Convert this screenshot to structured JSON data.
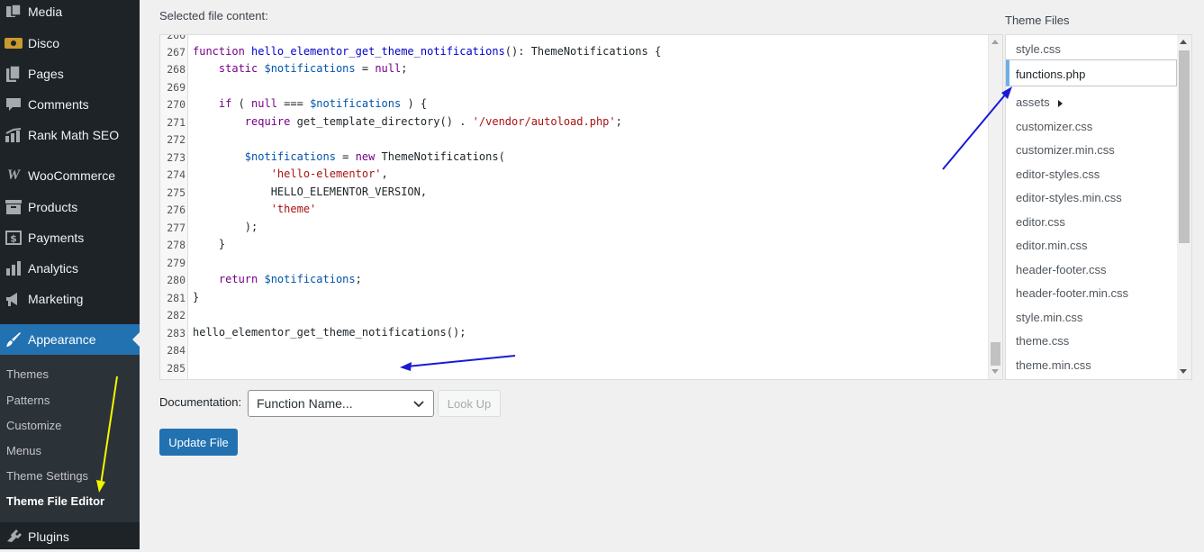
{
  "sidebar": {
    "menu": [
      {
        "label": "Media",
        "icon": "media-icon"
      },
      {
        "label": "Disco",
        "icon": "disco-icon"
      },
      {
        "label": "Pages",
        "icon": "pages-icon"
      },
      {
        "label": "Comments",
        "icon": "comments-icon"
      },
      {
        "label": "Rank Math SEO",
        "icon": "rank-math-icon"
      },
      {
        "label": "WooCommerce",
        "icon": "woocommerce-icon"
      },
      {
        "label": "Products",
        "icon": "products-icon"
      },
      {
        "label": "Payments",
        "icon": "payments-icon"
      },
      {
        "label": "Analytics",
        "icon": "analytics-icon"
      },
      {
        "label": "Marketing",
        "icon": "marketing-icon"
      },
      {
        "label": "Appearance",
        "icon": "appearance-icon"
      },
      {
        "label": "Plugins",
        "icon": "plugins-icon"
      }
    ],
    "submenu": [
      "Themes",
      "Patterns",
      "Customize",
      "Menus",
      "Theme Settings",
      "Theme File Editor"
    ]
  },
  "editor": {
    "label": "Selected file content:",
    "lines": [
      {
        "n": "267"
      },
      {
        "n": "268"
      },
      {
        "n": "269"
      },
      {
        "n": "270"
      },
      {
        "n": "271"
      },
      {
        "n": "272"
      },
      {
        "n": "273"
      },
      {
        "n": "274"
      },
      {
        "n": "275"
      },
      {
        "n": "276"
      },
      {
        "n": "277"
      },
      {
        "n": "278"
      },
      {
        "n": "279"
      },
      {
        "n": "280"
      },
      {
        "n": "281"
      },
      {
        "n": "282"
      },
      {
        "n": "283"
      },
      {
        "n": "284"
      },
      {
        "n": "285"
      }
    ],
    "code": {
      "l267_kw": "function ",
      "l267_fn": "hello_elementor_get_theme_notifications",
      "l267_rest": "(): ThemeNotifications {",
      "l268_kw": "static ",
      "l268_var": "$notifications",
      "l268_rest": " = ",
      "l268_null": "null",
      "l268_end": ";",
      "l270_kw": "if",
      "l270_a": " ( ",
      "l270_null": "null",
      "l270_b": " === ",
      "l270_var": "$notifications",
      "l270_c": " ) {",
      "l271_kw": "require ",
      "l271_a": "get_template_directory() . ",
      "l271_str": "'/vendor/autoload.php'",
      "l271_b": ";",
      "l273_var": "$notifications",
      "l273_a": " = ",
      "l273_kw": "new ",
      "l273_b": "ThemeNotifications(",
      "l274_str": "'hello-elementor'",
      "l274_a": ",",
      "l275": "HELLO_ELEMENTOR_VERSION,",
      "l276_str": "'theme'",
      "l277": ");",
      "l278": "}",
      "l280_kw": "return ",
      "l280_var": "$notifications",
      "l280_a": ";",
      "l281": "}",
      "l283": "hello_elementor_get_theme_notifications();"
    }
  },
  "theme_files": {
    "heading": "Theme Files",
    "files": [
      "style.css",
      "functions.php",
      "assets",
      "customizer.css",
      "customizer.min.css",
      "editor-styles.css",
      "editor-styles.min.css",
      "editor.css",
      "editor.min.css",
      "header-footer.css",
      "header-footer.min.css",
      "style.min.css",
      "theme.css",
      "theme.min.css"
    ],
    "selected": "functions.php"
  },
  "documentation": {
    "label": "Documentation:",
    "select_value": "Function Name...",
    "lookup_label": "Look Up"
  },
  "update_label": "Update File",
  "colors": {
    "sidebar_bg": "#1d2327",
    "accent": "#2271b1",
    "annotation_blue": "#1a1ad6",
    "annotation_yellow": "#f5f500"
  }
}
